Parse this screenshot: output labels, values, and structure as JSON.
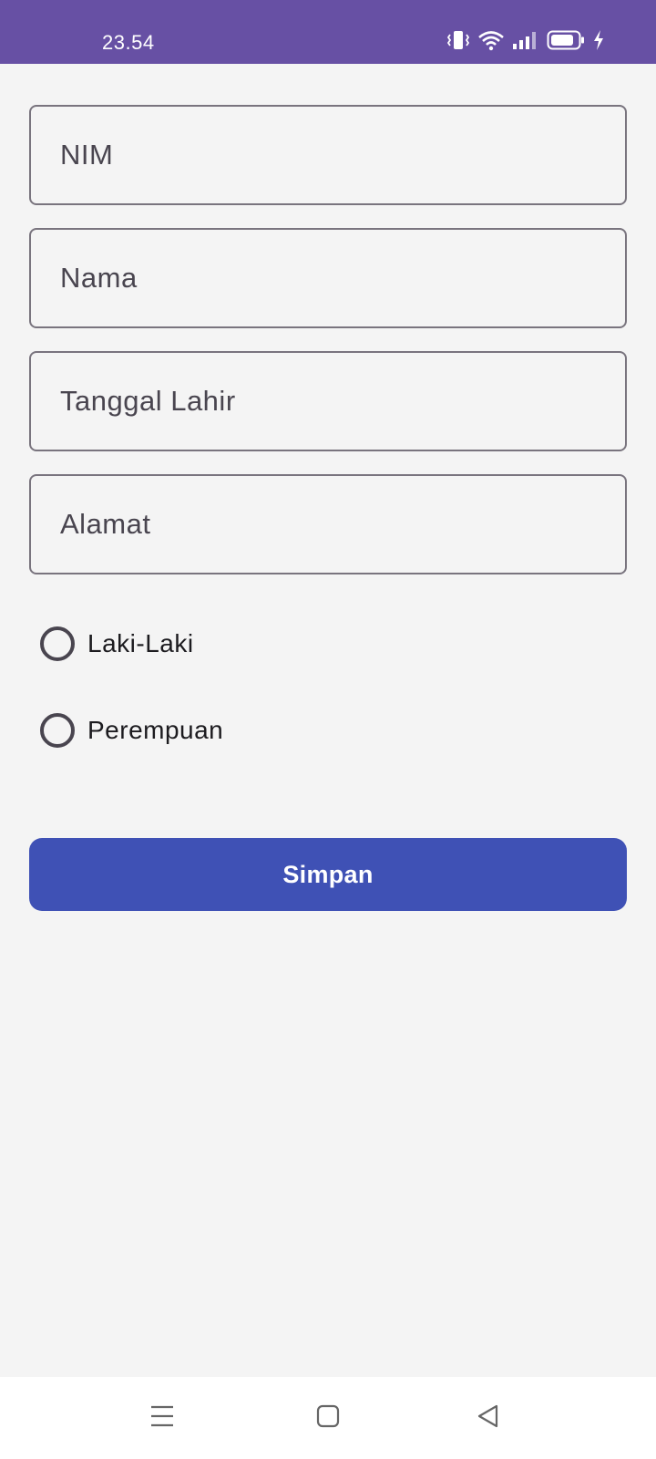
{
  "status_bar": {
    "time": "23.54",
    "background": "#6750a4",
    "icons": [
      "vibrate-icon",
      "wifi-icon",
      "signal-icon",
      "battery-icon",
      "charging-icon"
    ]
  },
  "form": {
    "fields": [
      {
        "placeholder": "NIM",
        "value": ""
      },
      {
        "placeholder": "Nama",
        "value": ""
      },
      {
        "placeholder": "Tanggal Lahir",
        "value": ""
      },
      {
        "placeholder": "Alamat",
        "value": ""
      }
    ],
    "gender_options": [
      {
        "label": "Laki-Laki",
        "selected": false
      },
      {
        "label": "Perempuan",
        "selected": false
      }
    ],
    "save_label": "Simpan",
    "accent_color": "#3f51b5"
  },
  "nav_bar": {
    "icons": [
      "menu-icon",
      "home-icon",
      "back-icon"
    ]
  }
}
